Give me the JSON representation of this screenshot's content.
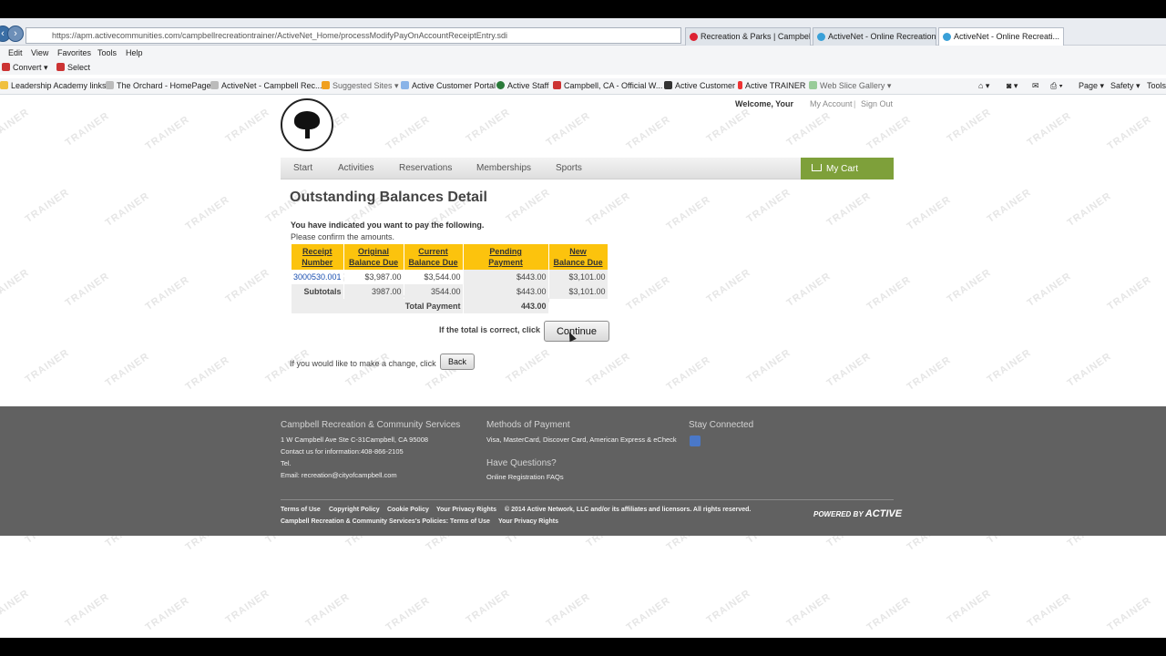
{
  "browser": {
    "url": "https://apm.activecommunities.com/campbellrecreationtrainer/ActiveNet_Home/processModifyPayOnAccountReceiptEntry.sdi",
    "tabs": [
      {
        "label": "Recreation & Parks | Campbell,..."
      },
      {
        "label": "ActiveNet - Online Recreation ..."
      },
      {
        "label": "ActiveNet - Online Recreati..."
      }
    ],
    "menu": [
      "Edit",
      "View",
      "Favorites",
      "Tools",
      "Help"
    ],
    "cmd": {
      "convert": "Convert",
      "select": "Select"
    },
    "favorites": [
      "Leadership Academy links",
      "The Orchard - HomePage",
      "ActiveNet - Campbell Rec...",
      "Suggested Sites",
      "Active Customer Portal",
      "Active Staff",
      "Campbell, CA - Official W...",
      "Active Customer",
      "Active TRAINER",
      "Web Slice Gallery"
    ],
    "toolbar": {
      "page": "Page",
      "safety": "Safety",
      "tools": "Tools"
    }
  },
  "watermark": "TRAINER",
  "header": {
    "welcome": "Welcome, Your",
    "my_account": "My Account",
    "sep": "|",
    "sign_out": "Sign Out"
  },
  "nav": {
    "items": [
      "Start",
      "Activities",
      "Reservations",
      "Memberships",
      "Sports"
    ],
    "cart": "My Cart"
  },
  "main": {
    "title": "Outstanding Balances Detail",
    "intro1": "You have indicated you want to pay the following.",
    "intro2": "Please confirm the amounts.",
    "table": {
      "headers": [
        [
          "Receipt",
          "Number"
        ],
        [
          "Original",
          "Balance Due"
        ],
        [
          "Current",
          "Balance Due"
        ],
        [
          "Pending",
          "Payment"
        ],
        [
          "New",
          "Balance Due"
        ]
      ],
      "row": [
        "3000530.001",
        "$3,987.00",
        "$3,544.00",
        "$443.00",
        "$3,101.00"
      ],
      "subtotals": [
        "Subtotals",
        "3987.00",
        "3544.00",
        "$443.00",
        "$3,101.00"
      ],
      "total": [
        "Total Payment",
        "443.00"
      ]
    },
    "confirm_text": "If the total is correct, click",
    "continue": "Continue",
    "change_text": "If you would like to make a change, click",
    "back": "Back"
  },
  "footer": {
    "col1_title": "Campbell Recreation & Community Services",
    "col1_lines": [
      "1 W Campbell Ave Ste C-31Campbell, CA 95008",
      "Contact us for information:408-866-2105",
      "Tel.",
      "Email: recreation@cityofcampbell.com"
    ],
    "col2_title": "Methods of Payment",
    "col2_text": "Visa, MasterCard, Discover Card, American Express & eCheck",
    "col2_title2": "Have Questions?",
    "col2_link": "Online Registration FAQs",
    "col3_title": "Stay Connected",
    "links_row1": [
      "Terms of Use",
      "Copyright Policy",
      "Cookie Policy",
      "Your Privacy Rights",
      "© 2014 Active Network, LLC and/or its affiliates and licensors. All rights reserved."
    ],
    "links_row2": [
      "Campbell Recreation & Community Services's Policies: Terms of Use",
      "Your Privacy Rights"
    ],
    "powered_prefix": "POWERED BY",
    "powered_brand": "ACTIVE"
  }
}
